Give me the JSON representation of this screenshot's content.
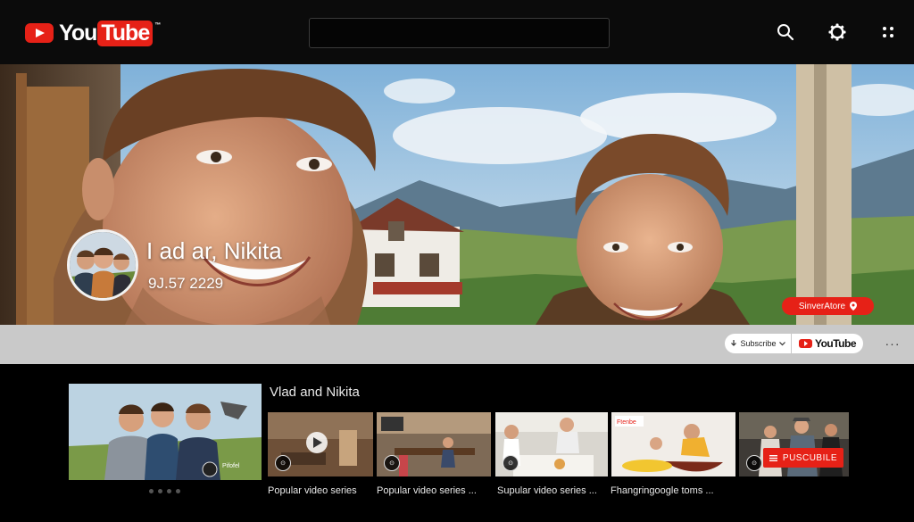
{
  "app": {
    "logo_you": "You",
    "logo_tube": "Tube",
    "logo_tm": "™",
    "accent_color": "#e62117"
  },
  "topbar": {
    "search_placeholder": "",
    "icons": [
      "search-icon",
      "gear-icon",
      "apps-icon"
    ]
  },
  "channel": {
    "name": "I ad ar, Nikita",
    "subscriber_text": "9J.57 2229",
    "store_label": "SinverAtore",
    "subscribe_label": "Subscribe",
    "youtube_button_label": "YouTube",
    "more_label": "···"
  },
  "content": {
    "section_title": "Vlad and Nikita",
    "featured_caption": "Pifofel",
    "carousel_dots": 4,
    "videos": [
      {
        "title": "Popular video series"
      },
      {
        "title": "Popular video series ..."
      },
      {
        "title": "Supular video series ..."
      },
      {
        "title": "Fhangringoogle toms ...",
        "thumb_text": "Ftenbe"
      },
      {
        "title": "",
        "button_label": "PUSCUBILE"
      }
    ]
  }
}
